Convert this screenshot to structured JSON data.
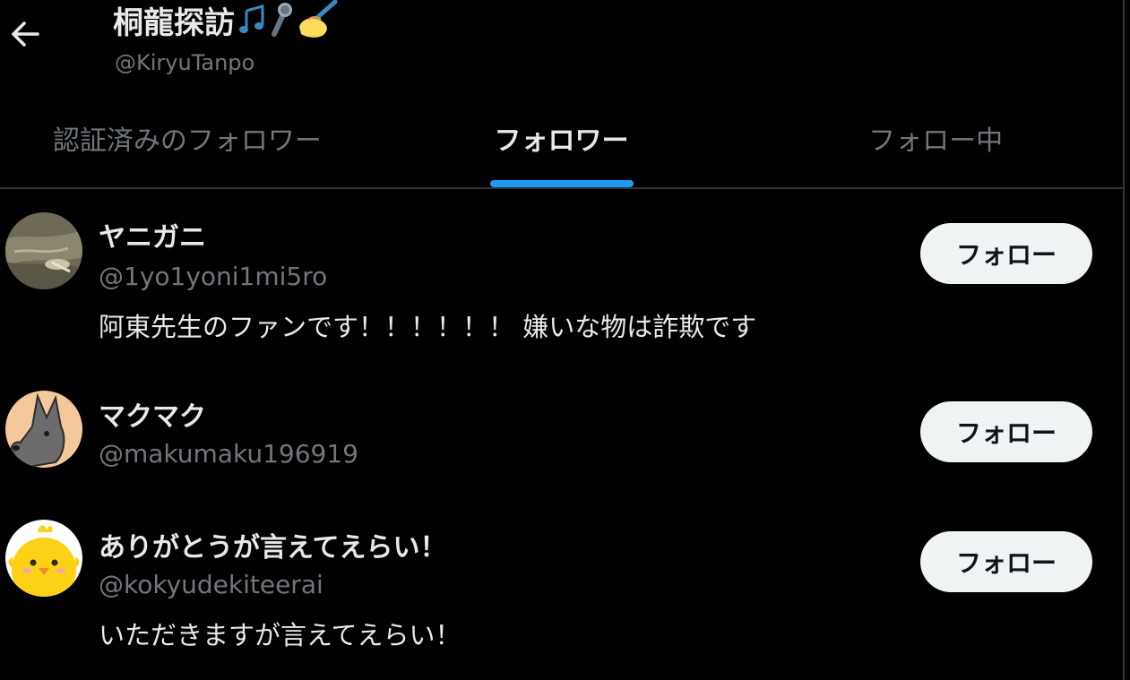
{
  "header": {
    "title": "桐龍探訪",
    "handle": "@KiryuTanpo",
    "title_emoji_icons": [
      "notes-icon",
      "microphone-icon",
      "writing-hand-icon"
    ]
  },
  "tabs": [
    {
      "label": "認証済みのフォロワー",
      "active": false
    },
    {
      "label": "フォロワー",
      "active": true
    },
    {
      "label": "フォロー中",
      "active": false
    }
  ],
  "followers": [
    {
      "name": "ヤニガニ",
      "handle": "@1yo1yoni1mi5ro",
      "bio": "阿東先生のファンです！！！！！！ 嫌いな物は詐欺です",
      "follow_label": "フォロー",
      "avatar_icon": "photo-avatar"
    },
    {
      "name": "マクマク",
      "handle": "@makumaku196919",
      "bio": "",
      "follow_label": "フォロー",
      "avatar_icon": "dog-avatar"
    },
    {
      "name": "ありがとうが言えてえらい！",
      "handle": "@kokyudekiteerai",
      "bio": "いただきますが言えてえらい！",
      "follow_label": "フォロー",
      "avatar_icon": "chick-avatar"
    }
  ],
  "colors": {
    "background": "#000000",
    "text_primary": "#e7e9ea",
    "text_secondary": "#71767b",
    "accent": "#1d9bf0",
    "divider": "#2f3336",
    "button_bg": "#eff3f4",
    "button_text": "#0f1419"
  }
}
